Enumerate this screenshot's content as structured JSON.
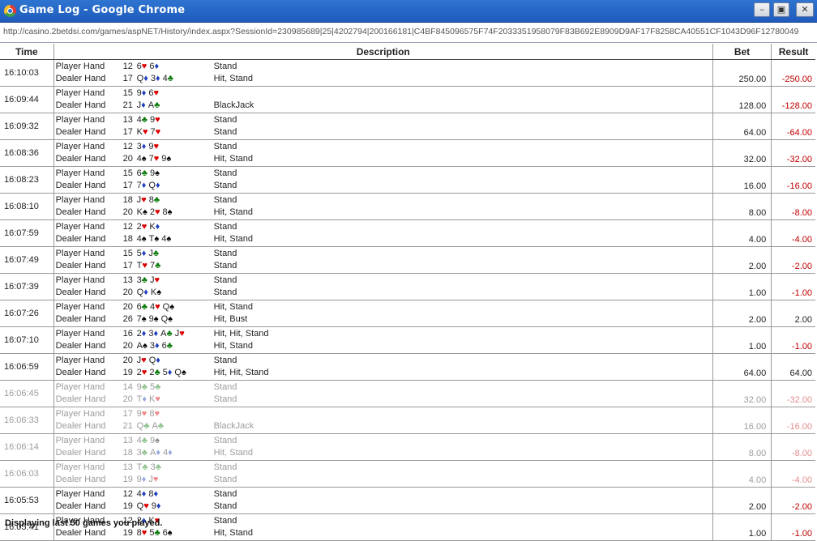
{
  "window": {
    "title": "Game Log - Google Chrome",
    "address": "http://casino.2betdsi.com/games/aspNET/History/index.aspx?SessionId=230985689|25|4202794|200166181|C4BF845096575F74F2033351958079F83B692E8909D9AF17F8258CA40551CF1043D96F12780049"
  },
  "columns": {
    "time": "Time",
    "description": "Description",
    "bet": "Bet",
    "result": "Result"
  },
  "rows": [
    {
      "time": "16:10:03",
      "player": {
        "label": "Player Hand",
        "total": "12",
        "cards": "6♥ 6♦",
        "action": "Stand"
      },
      "dealer": {
        "label": "Dealer Hand",
        "total": "17",
        "cards": "Q♦ 3♦ 4♣",
        "action": "Hit, Stand"
      },
      "bet": "250.00",
      "result": "-250.00",
      "neg": true
    },
    {
      "time": "16:09:44",
      "player": {
        "label": "Player Hand",
        "total": "15",
        "cards": "9♦ 6♥",
        "action": ""
      },
      "dealer": {
        "label": "Dealer Hand",
        "total": "21",
        "cards": "J♦ A♣",
        "action": "BlackJack"
      },
      "bet": "128.00",
      "result": "-128.00",
      "neg": true
    },
    {
      "time": "16:09:32",
      "player": {
        "label": "Player Hand",
        "total": "13",
        "cards": "4♣ 9♥",
        "action": "Stand"
      },
      "dealer": {
        "label": "Dealer Hand",
        "total": "17",
        "cards": "K♥ 7♥",
        "action": "Stand"
      },
      "bet": "64.00",
      "result": "-64.00",
      "neg": true
    },
    {
      "time": "16:08:36",
      "player": {
        "label": "Player Hand",
        "total": "12",
        "cards": "3♦ 9♥",
        "action": "Stand"
      },
      "dealer": {
        "label": "Dealer Hand",
        "total": "20",
        "cards": "4♠ 7♥ 9♠",
        "action": "Hit, Stand"
      },
      "bet": "32.00",
      "result": "-32.00",
      "neg": true
    },
    {
      "time": "16:08:23",
      "player": {
        "label": "Player Hand",
        "total": "15",
        "cards": "6♣ 9♠",
        "action": "Stand"
      },
      "dealer": {
        "label": "Dealer Hand",
        "total": "17",
        "cards": "7♦ Q♦",
        "action": "Stand"
      },
      "bet": "16.00",
      "result": "-16.00",
      "neg": true
    },
    {
      "time": "16:08:10",
      "player": {
        "label": "Player Hand",
        "total": "18",
        "cards": "J♥ 8♣",
        "action": "Stand"
      },
      "dealer": {
        "label": "Dealer Hand",
        "total": "20",
        "cards": "K♠ 2♥ 8♠",
        "action": "Hit, Stand"
      },
      "bet": "8.00",
      "result": "-8.00",
      "neg": true
    },
    {
      "time": "16:07:59",
      "player": {
        "label": "Player Hand",
        "total": "12",
        "cards": "2♥ K♦",
        "action": "Stand"
      },
      "dealer": {
        "label": "Dealer Hand",
        "total": "18",
        "cards": "4♠ T♠ 4♠",
        "action": "Hit, Stand"
      },
      "bet": "4.00",
      "result": "-4.00",
      "neg": true
    },
    {
      "time": "16:07:49",
      "player": {
        "label": "Player Hand",
        "total": "15",
        "cards": "5♦ J♣",
        "action": "Stand"
      },
      "dealer": {
        "label": "Dealer Hand",
        "total": "17",
        "cards": "T♥ 7♣",
        "action": "Stand"
      },
      "bet": "2.00",
      "result": "-2.00",
      "neg": true
    },
    {
      "time": "16:07:39",
      "player": {
        "label": "Player Hand",
        "total": "13",
        "cards": "3♣ J♥",
        "action": "Stand"
      },
      "dealer": {
        "label": "Dealer Hand",
        "total": "20",
        "cards": "Q♦ K♠",
        "action": "Stand"
      },
      "bet": "1.00",
      "result": "-1.00",
      "neg": true
    },
    {
      "time": "16:07:26",
      "player": {
        "label": "Player Hand",
        "total": "20",
        "cards": "6♣ 4♥ Q♠",
        "action": "Hit, Stand"
      },
      "dealer": {
        "label": "Dealer Hand",
        "total": "26",
        "cards": "7♠ 9♠ Q♠",
        "action": "Hit, Bust"
      },
      "bet": "2.00",
      "result": "2.00",
      "neg": false
    },
    {
      "time": "16:07:10",
      "player": {
        "label": "Player Hand",
        "total": "16",
        "cards": "2♦ 3♦ A♣ J♥",
        "action": "Hit, Hit, Stand"
      },
      "dealer": {
        "label": "Dealer Hand",
        "total": "20",
        "cards": "A♠ 3♦ 6♣",
        "action": "Hit, Stand"
      },
      "bet": "1.00",
      "result": "-1.00",
      "neg": true
    },
    {
      "time": "16:06:59",
      "player": {
        "label": "Player Hand",
        "total": "20",
        "cards": "J♥ Q♦",
        "action": "Stand"
      },
      "dealer": {
        "label": "Dealer Hand",
        "total": "19",
        "cards": "2♥ 2♣ 5♦ Q♠",
        "action": "Hit, Hit, Stand"
      },
      "bet": "64.00",
      "result": "64.00",
      "neg": false
    },
    {
      "time": "16:06:45",
      "player": {
        "label": "Player Hand",
        "total": "14",
        "cards": "9♣ 5♣",
        "action": "Stand"
      },
      "dealer": {
        "label": "Dealer Hand",
        "total": "20",
        "cards": "T♦ K♥",
        "action": "Stand"
      },
      "bet": "32.00",
      "result": "-32.00",
      "neg": true
    },
    {
      "time": "16:06:33",
      "player": {
        "label": "Player Hand",
        "total": "17",
        "cards": "9♥ 8♥",
        "action": ""
      },
      "dealer": {
        "label": "Dealer Hand",
        "total": "21",
        "cards": "Q♣ A♣",
        "action": "BlackJack"
      },
      "bet": "16.00",
      "result": "-16.00",
      "neg": true
    },
    {
      "time": "16:06:14",
      "player": {
        "label": "Player Hand",
        "total": "13",
        "cards": "4♣ 9♠",
        "action": "Stand"
      },
      "dealer": {
        "label": "Dealer Hand",
        "total": "18",
        "cards": "3♣ A♦ 4♦",
        "action": "Hit, Stand"
      },
      "bet": "8.00",
      "result": "-8.00",
      "neg": true
    },
    {
      "time": "16:06:03",
      "player": {
        "label": "Player Hand",
        "total": "13",
        "cards": "T♣ 3♣",
        "action": "Stand"
      },
      "dealer": {
        "label": "Dealer Hand",
        "total": "19",
        "cards": "9♦ J♥",
        "action": "Stand"
      },
      "bet": "4.00",
      "result": "-4.00",
      "neg": true
    },
    {
      "time": "16:05:53",
      "player": {
        "label": "Player Hand",
        "total": "12",
        "cards": "4♦ 8♦",
        "action": "Stand"
      },
      "dealer": {
        "label": "Dealer Hand",
        "total": "19",
        "cards": "Q♥ 9♦",
        "action": "Stand"
      },
      "bet": "2.00",
      "result": "-2.00",
      "neg": true
    },
    {
      "time": "16:05:41",
      "player": {
        "label": "Player Hand",
        "total": "12",
        "cards": "2♦ K♥",
        "action": "Stand"
      },
      "dealer": {
        "label": "Dealer Hand",
        "total": "19",
        "cards": "8♥ 5♣ 6♠",
        "action": "Hit, Stand"
      },
      "bet": "1.00",
      "result": "-1.00",
      "neg": true
    }
  ],
  "footer": "Displaying last 50 games you played.",
  "colors": {
    "negative": "#c00000",
    "titlebar": "#2f74d0"
  }
}
